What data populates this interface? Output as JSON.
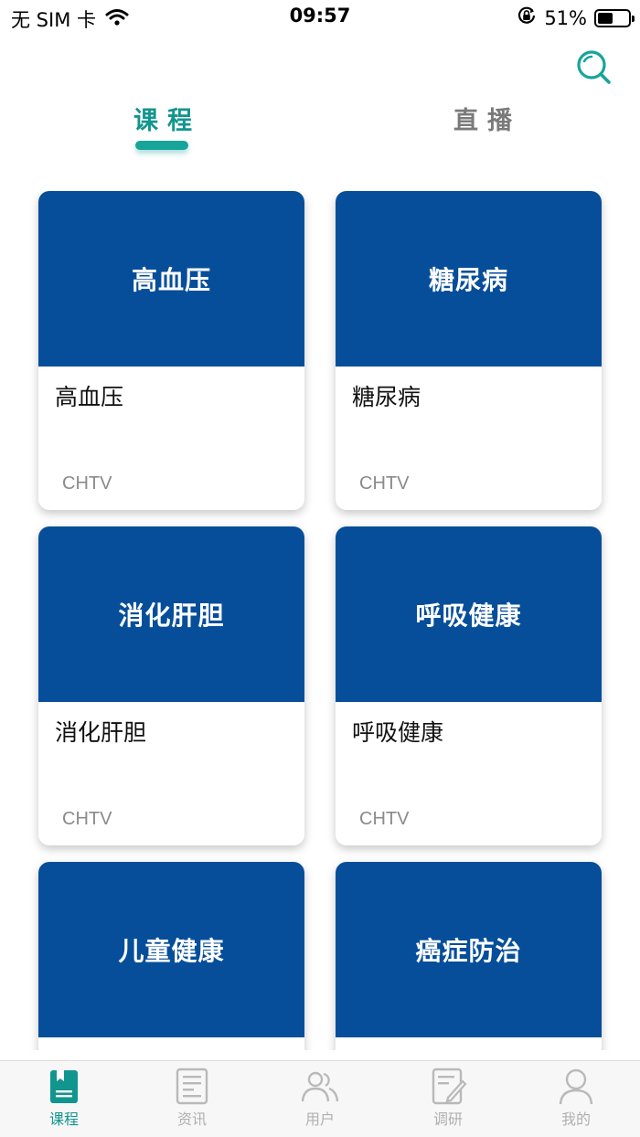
{
  "status_bar": {
    "carrier": "无 SIM 卡",
    "time": "09:57",
    "battery_text": "51%",
    "battery_level": 0.51
  },
  "top_tabs": [
    {
      "label": "课程",
      "active": true
    },
    {
      "label": "直播",
      "active": false
    }
  ],
  "courses": [
    {
      "banner": "高血压",
      "title": "高血压",
      "source": "CHTV"
    },
    {
      "banner": "糖尿病",
      "title": "糖尿病",
      "source": "CHTV"
    },
    {
      "banner": "消化肝胆",
      "title": "消化肝胆",
      "source": "CHTV"
    },
    {
      "banner": "呼吸健康",
      "title": "呼吸健康",
      "source": "CHTV"
    },
    {
      "banner": "儿童健康",
      "title": "",
      "source": ""
    },
    {
      "banner": "癌症防治",
      "title": "",
      "source": ""
    }
  ],
  "tab_bar": [
    {
      "label": "课程",
      "icon": "book-icon",
      "active": true
    },
    {
      "label": "资讯",
      "icon": "news-icon",
      "active": false
    },
    {
      "label": "用户",
      "icon": "users-icon",
      "active": false
    },
    {
      "label": "调研",
      "icon": "survey-icon",
      "active": false
    },
    {
      "label": "我的",
      "icon": "profile-icon",
      "active": false
    }
  ],
  "colors": {
    "accent": "#12958e",
    "banner": "#064e9a",
    "inactive": "#b0b0b0"
  }
}
